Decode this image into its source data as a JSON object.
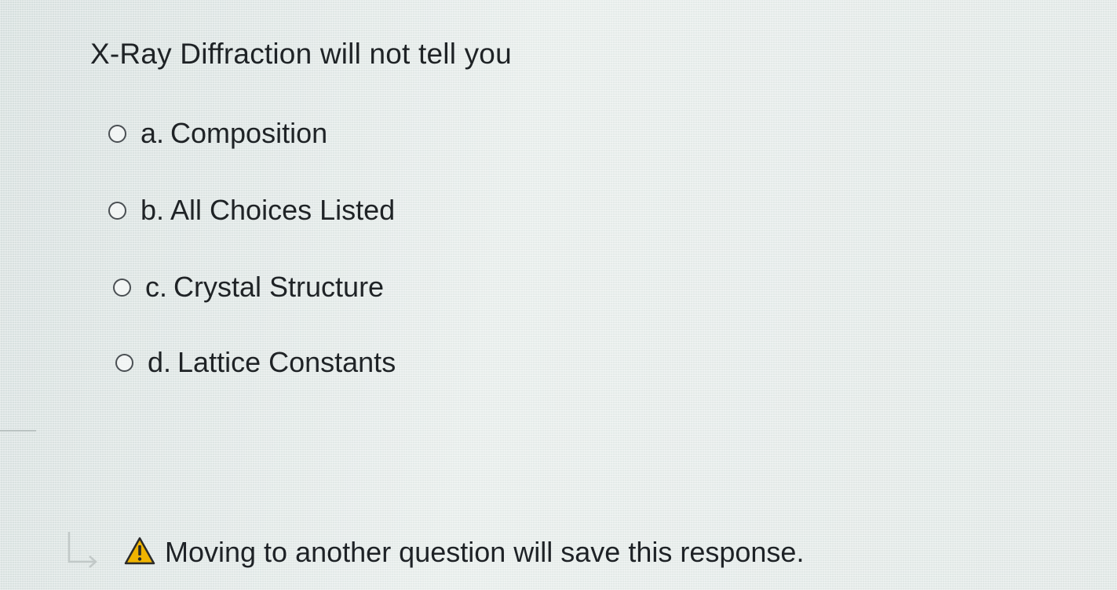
{
  "question": {
    "text": "X-Ray Diffraction will not tell you"
  },
  "choices": [
    {
      "letter": "a.",
      "label": "Composition"
    },
    {
      "letter": "b.",
      "label": "All Choices Listed"
    },
    {
      "letter": "c.",
      "label": "Crystal Structure"
    },
    {
      "letter": "d.",
      "label": "Lattice Constants"
    }
  ],
  "footer": {
    "notice": "Moving to another question will save this response.",
    "icons": [
      "return-arrow-icon",
      "warning-icon"
    ],
    "warning_color": "#f0b400"
  }
}
